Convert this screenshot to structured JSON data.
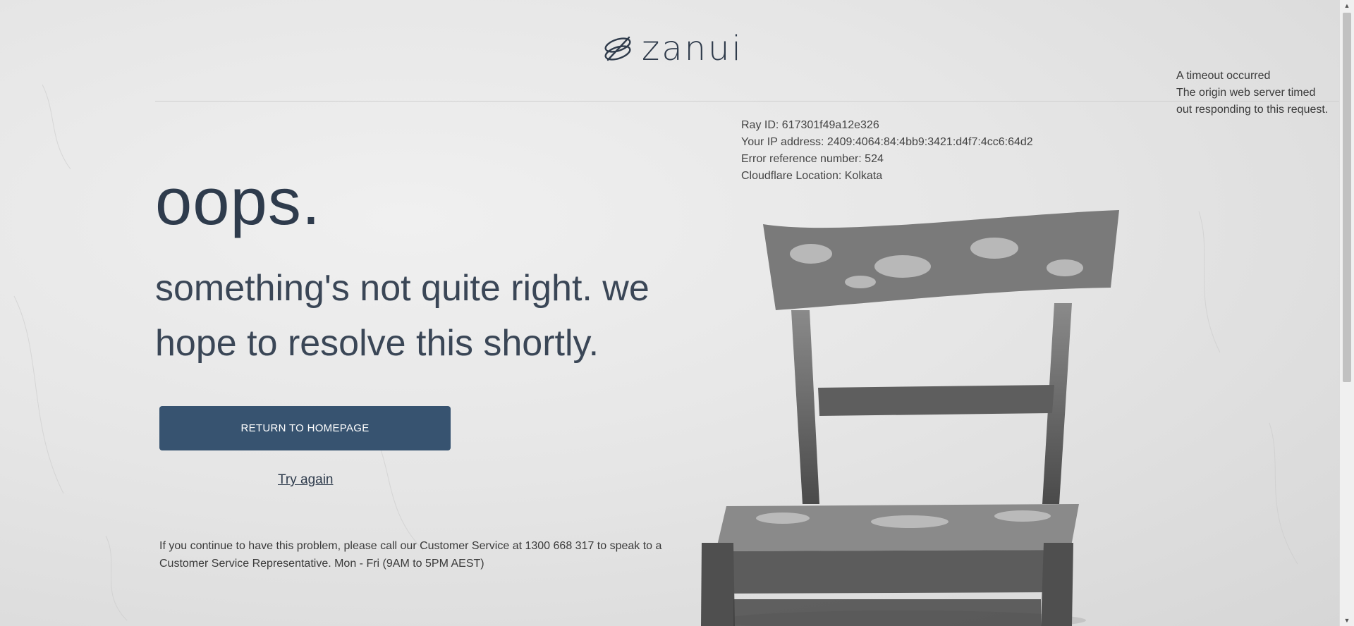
{
  "brand": {
    "name": "zanui",
    "logo_icon": "zanui-swirl-icon"
  },
  "timeout": {
    "title": "A timeout occurred",
    "line1": "The origin web server timed",
    "line2": "out responding to this request."
  },
  "error_info": {
    "ray_id": "Ray ID: 617301f49a12e326",
    "ip": "Your IP address: 2409:4064:84:4bb9:3421:d4f7:4cc6:64d2",
    "reference": "Error reference number: 524",
    "location": "Cloudflare Location: Kolkata"
  },
  "message": {
    "heading": "oops.",
    "subheading": "something's not quite right. we hope to resolve this shortly."
  },
  "actions": {
    "return_label": "RETURN TO HOMEPAGE",
    "try_again_label": "Try again"
  },
  "contact": {
    "text": "If you continue to have this problem, please call our Customer Service at 1300 668 317 to speak to a Customer Service Representative. Mon - Fri (9AM to 5PM AEST)"
  },
  "colors": {
    "button_bg": "#375370",
    "text_primary": "#2e3b4c",
    "background": "#e6e6e6"
  },
  "images": {
    "background_photo": "old-wooden-chair-photo"
  }
}
